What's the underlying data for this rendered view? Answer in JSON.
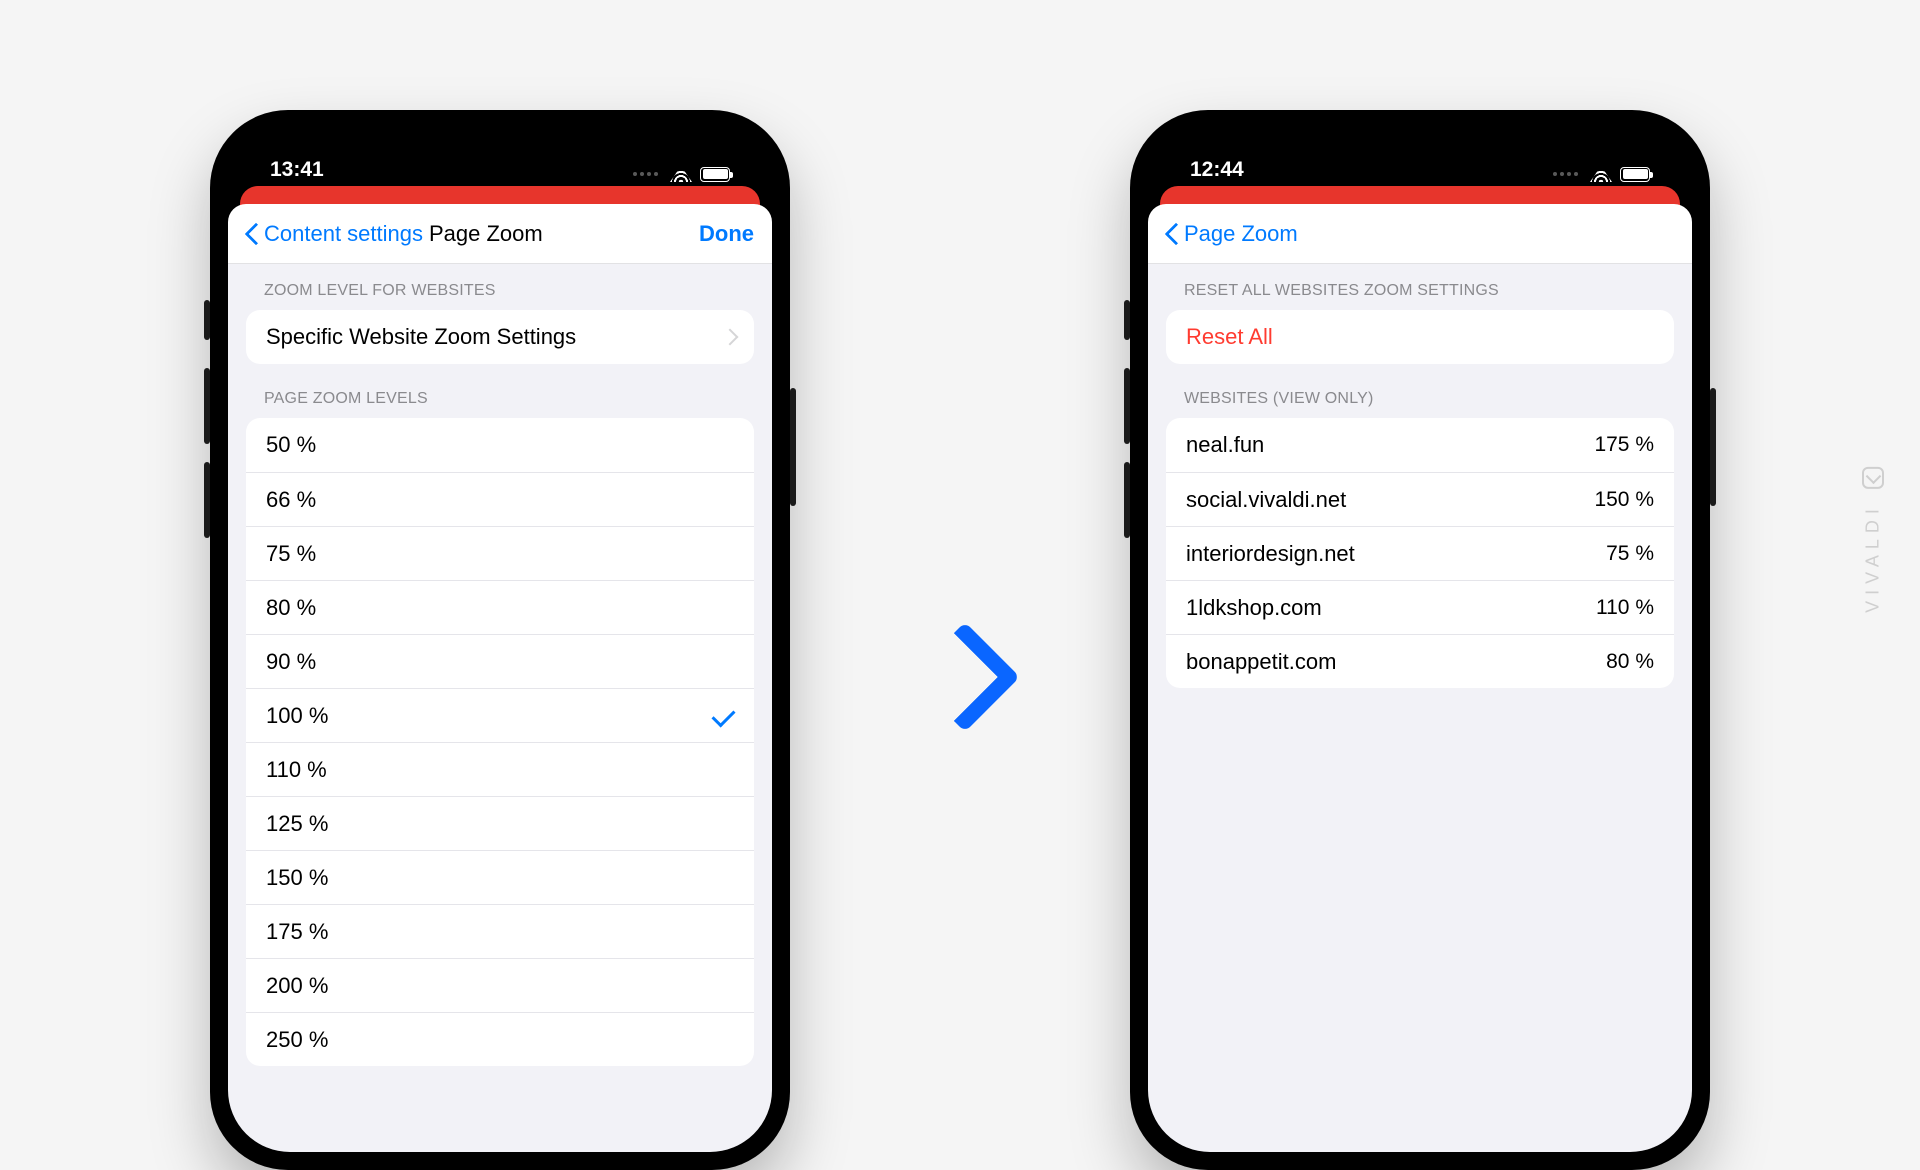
{
  "watermark": "VIVALDI",
  "left": {
    "status_time": "13:41",
    "nav_back": "Content settings",
    "nav_title": "Page Zoom",
    "nav_done": "Done",
    "section1_header": "ZOOM LEVEL FOR WEBSITES",
    "section1_row": "Specific Website Zoom Settings",
    "section2_header": "PAGE ZOOM LEVELS",
    "zoom_levels": [
      {
        "label": "50 %",
        "selected": false
      },
      {
        "label": "66 %",
        "selected": false
      },
      {
        "label": "75 %",
        "selected": false
      },
      {
        "label": "80 %",
        "selected": false
      },
      {
        "label": "90 %",
        "selected": false
      },
      {
        "label": "100 %",
        "selected": true
      },
      {
        "label": "110 %",
        "selected": false
      },
      {
        "label": "125 %",
        "selected": false
      },
      {
        "label": "150 %",
        "selected": false
      },
      {
        "label": "175 %",
        "selected": false
      },
      {
        "label": "200 %",
        "selected": false
      },
      {
        "label": "250 %",
        "selected": false
      }
    ]
  },
  "right": {
    "status_time": "12:44",
    "nav_back": "Page Zoom",
    "section1_header": "RESET ALL WEBSITES ZOOM SETTINGS",
    "reset_label": "Reset All",
    "section2_header": "WEBSITES (VIEW ONLY)",
    "sites": [
      {
        "host": "neal.fun",
        "zoom": "175 %"
      },
      {
        "host": "social.vivaldi.net",
        "zoom": "150 %"
      },
      {
        "host": "interiordesign.net",
        "zoom": "75 %"
      },
      {
        "host": "1ldkshop.com",
        "zoom": "110 %"
      },
      {
        "host": "bonappetit.com",
        "zoom": "80 %"
      }
    ]
  }
}
